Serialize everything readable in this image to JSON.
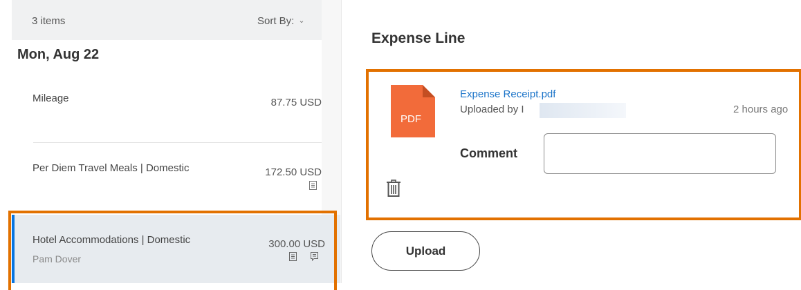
{
  "list": {
    "count_label": "3 items",
    "sort_label": "Sort By:",
    "date_heading": "Mon, Aug 22",
    "items": [
      {
        "name": "Mileage",
        "amount": "87.75 USD"
      },
      {
        "name": "Per Diem Travel Meals | Domestic",
        "amount": "172.50 USD",
        "icons": [
          "receipt-icon"
        ]
      },
      {
        "name": "Hotel Accommodations | Domestic",
        "amount": "300.00 USD",
        "subtitle": "Pam Dover",
        "icons": [
          "receipt-icon",
          "comment-icon"
        ],
        "selected": true
      }
    ]
  },
  "detail": {
    "title": "Expense Line",
    "attachment": {
      "file_name": "Expense Receipt.pdf",
      "file_type": "PDF",
      "uploaded_by_prefix": "Uploaded by",
      "uploaded_by_name_initial": "I",
      "time_ago": "2 hours ago",
      "comment_label": "Comment",
      "comment_value": ""
    },
    "upload_label": "Upload"
  },
  "colors": {
    "highlight": "#e27100",
    "pdf_icon": "#f26b3a",
    "link": "#1a73c8",
    "selected_bg": "#e7ebef",
    "selected_bar": "#0875e1"
  }
}
